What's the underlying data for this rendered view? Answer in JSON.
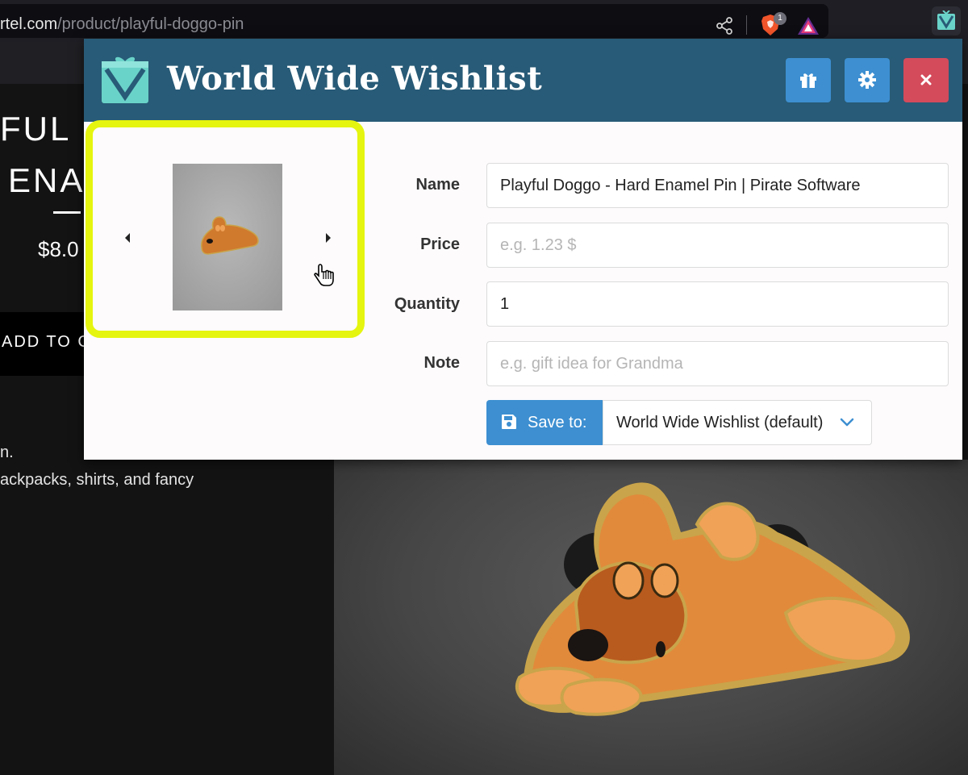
{
  "browser": {
    "url_domain": "rtel.com",
    "url_path": "/product/playful-doggo-pin",
    "shields_badge": "1"
  },
  "page": {
    "title_line1": "FUL D",
    "title_line2": "ENA",
    "price": "$8.0",
    "add_button": "ADD TO C",
    "description_line1": "n.",
    "description_line2": "ackpacks, shirts, and fancy"
  },
  "popup": {
    "title": "World Wide Wishlist",
    "form": {
      "name_label": "Name",
      "name_value": "Playful Doggo - Hard Enamel Pin | Pirate Software",
      "price_label": "Price",
      "price_placeholder": "e.g. 1.23 $",
      "quantity_label": "Quantity",
      "quantity_value": "1",
      "note_label": "Note",
      "note_placeholder": "e.g. gift idea for Grandma",
      "save_label": "Save to:",
      "wishlist_selected": "World Wide Wishlist (default)"
    },
    "icons": [
      "gift-icon",
      "gear-icon",
      "close-icon",
      "floppy-disk-icon",
      "chevron-down-icon"
    ]
  },
  "colors": {
    "header": "#285b77",
    "primary_button": "#3d8fd1",
    "close_button": "#d44b5b",
    "highlight": "#e5f50f"
  }
}
